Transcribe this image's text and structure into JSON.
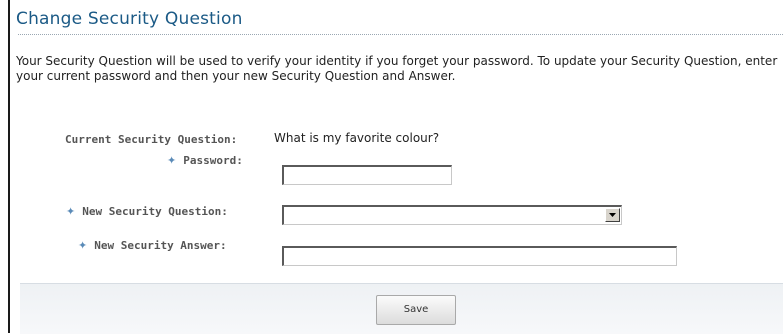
{
  "page": {
    "title": "Change Security Question",
    "description": "Your Security Question will be used to verify your identity if you forget your password. To update your Security Question, enter your current password and then your new Security Question and Answer."
  },
  "form": {
    "current_question_label": "Current Security Question:",
    "current_question_value": "What is my favorite colour?",
    "password_label": "Password:",
    "password_value": "",
    "new_question_label": "New Security Question:",
    "new_question_value": "",
    "new_answer_label": "New Security Answer:",
    "new_answer_value": "",
    "required_marker": "✦"
  },
  "footer": {
    "save_label": "Save"
  },
  "colors": {
    "title": "#1b5a86",
    "required_marker": "#5b8bb8",
    "label": "#555555"
  }
}
